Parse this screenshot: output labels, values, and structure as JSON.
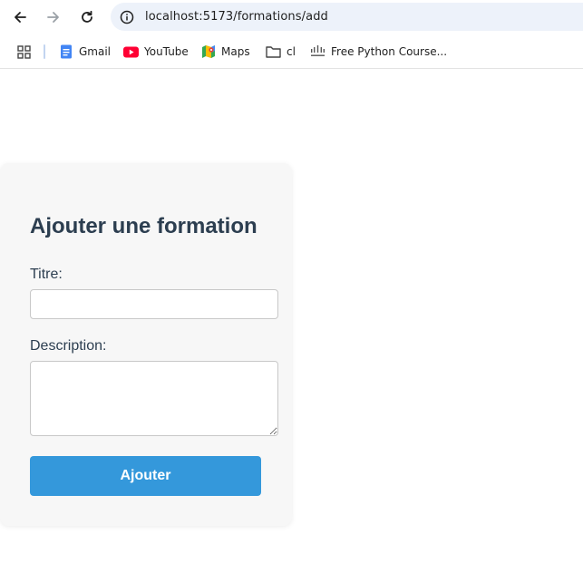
{
  "browser": {
    "url": "localhost:5173/formations/add",
    "icons": [
      "back-arrow-icon",
      "forward-arrow-icon",
      "reload-icon",
      "site-info-icon"
    ],
    "bookmarks": [
      {
        "label": "Gmail",
        "icon": "gmail-icon"
      },
      {
        "label": "YouTube",
        "icon": "youtube-icon"
      },
      {
        "label": "Maps",
        "icon": "maps-icon"
      },
      {
        "label": "cl",
        "icon": "folder-icon"
      },
      {
        "label": "Free Python Course...",
        "icon": "cisco-icon"
      }
    ]
  },
  "form": {
    "title": "Ajouter une formation",
    "titre_label": "Titre:",
    "titre_value": "",
    "description_label": "Description:",
    "description_value": "",
    "submit_label": "Ajouter"
  },
  "colors": {
    "accent": "#3498db",
    "text": "#2c3e50",
    "card_bg": "#f7f7f7",
    "omnibox_bg": "#edf2fa"
  }
}
